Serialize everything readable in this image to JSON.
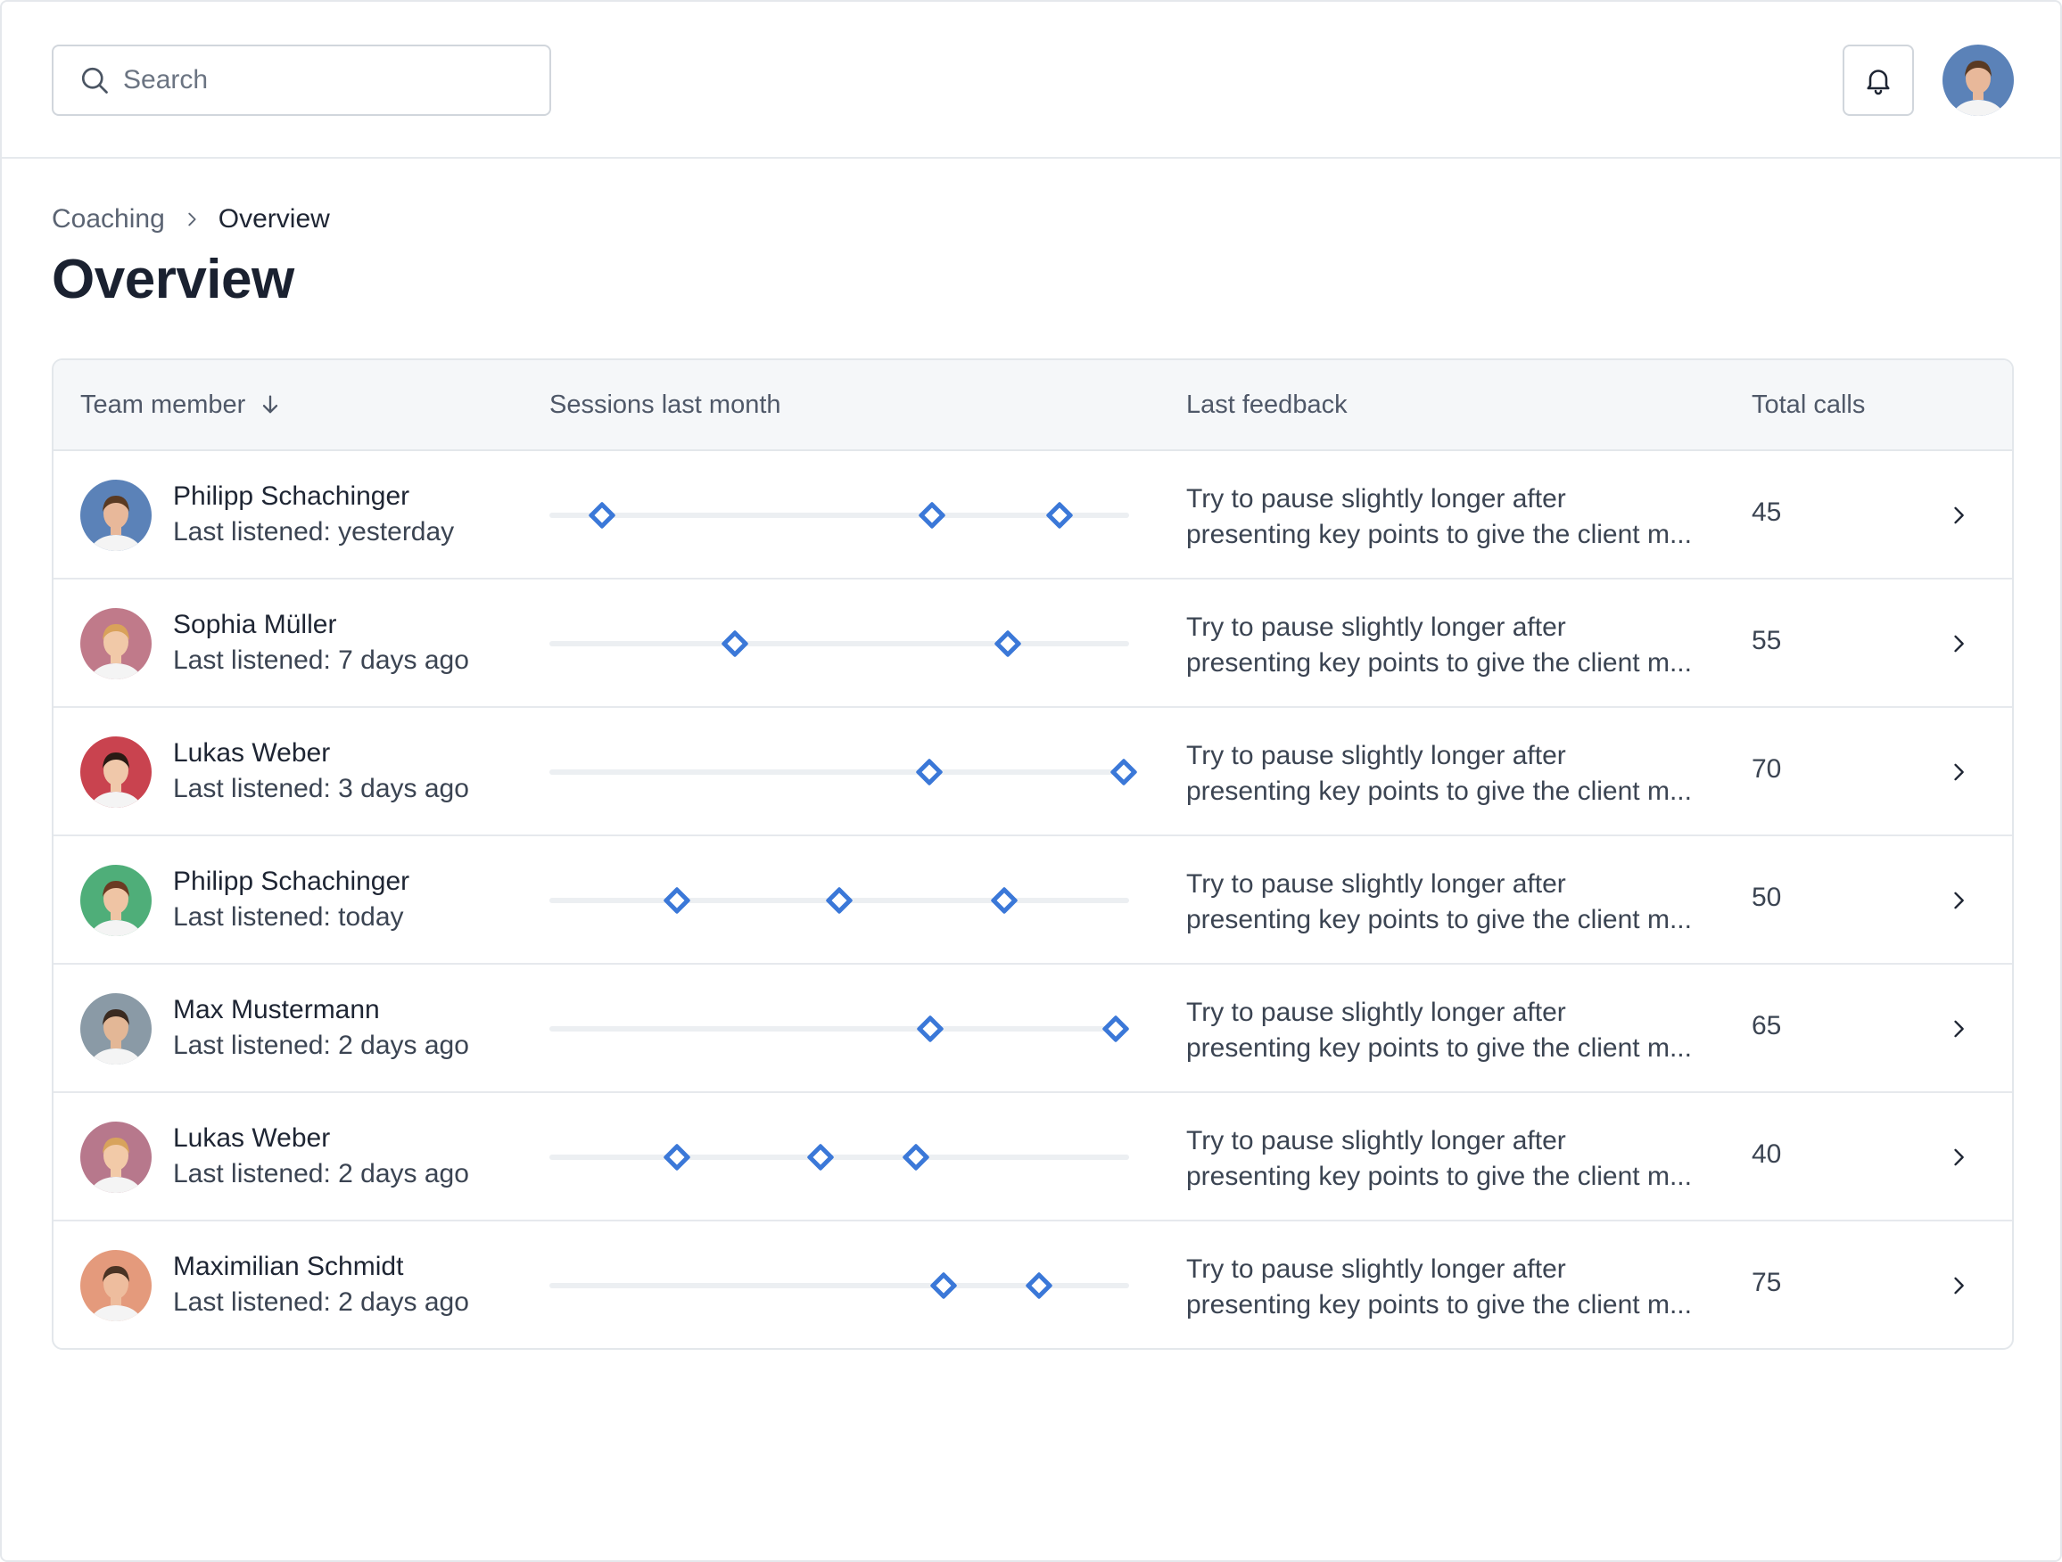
{
  "search": {
    "placeholder": "Search",
    "value": ""
  },
  "breadcrumb": {
    "parent": "Coaching",
    "current": "Overview"
  },
  "page_title": "Overview",
  "table": {
    "columns": {
      "member": "Team member",
      "sessions": "Sessions last month",
      "feedback": "Last feedback",
      "calls": "Total calls"
    },
    "rows": [
      {
        "name": "Philipp Schachinger",
        "listened": "Last listened: yesterday",
        "feedback_line1": "Try to pause slightly longer after",
        "feedback_line2": "presenting key points to give the client m...",
        "calls": "45",
        "sessions": [
          0.09,
          0.66,
          0.88
        ],
        "avatar_bg": "#5b82b8",
        "skin": "#e8b89a",
        "hair": "#5a3a22"
      },
      {
        "name": "Sophia Müller",
        "listened": "Last listened: 7 days ago",
        "feedback_line1": "Try to pause slightly longer after",
        "feedback_line2": "presenting key points to give the client m...",
        "calls": "55",
        "sessions": [
          0.32,
          0.79
        ],
        "avatar_bg": "#c07a8a",
        "skin": "#f1c9a8",
        "hair": "#d9a25a"
      },
      {
        "name": "Lukas Weber",
        "listened": "Last listened: 3 days ago",
        "feedback_line1": "Try to pause slightly longer after",
        "feedback_line2": "presenting key points to give the client m...",
        "calls": "70",
        "sessions": [
          0.655,
          0.99
        ],
        "avatar_bg": "#c9434f",
        "skin": "#f0c8aa",
        "hair": "#2a1a14"
      },
      {
        "name": "Philipp Schachinger",
        "listened": "Last listened: today",
        "feedback_line1": "Try to pause slightly longer after",
        "feedback_line2": "presenting key points to give the client m...",
        "calls": "50",
        "sessions": [
          0.22,
          0.5,
          0.785
        ],
        "avatar_bg": "#4fae79",
        "skin": "#efc4a4",
        "hair": "#6b3a22"
      },
      {
        "name": "Max Mustermann",
        "listened": "Last listened: 2 days ago",
        "feedback_line1": "Try to pause slightly longer after",
        "feedback_line2": "presenting key points to give the client m...",
        "calls": "65",
        "sessions": [
          0.657,
          0.977
        ],
        "avatar_bg": "#8a9aa6",
        "skin": "#e3b796",
        "hair": "#3a2a20"
      },
      {
        "name": "Lukas Weber",
        "listened": "Last listened: 2 days ago",
        "feedback_line1": "Try to pause slightly longer after",
        "feedback_line2": "presenting key points to give the client m...",
        "calls": "40",
        "sessions": [
          0.22,
          0.468,
          0.632
        ],
        "avatar_bg": "#b7788c",
        "skin": "#f2caa8",
        "hair": "#d8a35c"
      },
      {
        "name": "Maximilian Schmidt",
        "listened": "Last listened: 2 days ago",
        "feedback_line1": "Try to pause slightly longer after",
        "feedback_line2": "presenting key points to give the client m...",
        "calls": "75",
        "sessions": [
          0.68,
          0.845
        ],
        "avatar_bg": "#e49a7c",
        "skin": "#eebd9e",
        "hair": "#4a3324"
      }
    ]
  },
  "header_avatar": {
    "avatar_bg": "#5b82b8",
    "skin": "#e8b89a",
    "hair": "#5a3a22"
  },
  "icons": {
    "search": "search-icon",
    "bell": "bell-icon",
    "sort": "arrow-down-icon",
    "chevron": "chevron-right-icon",
    "breadcrumb_sep": "chevron-right-icon"
  },
  "colors": {
    "accent": "#3b78d8",
    "header_bg": "#f5f7f9",
    "border": "#e3e7eb"
  }
}
